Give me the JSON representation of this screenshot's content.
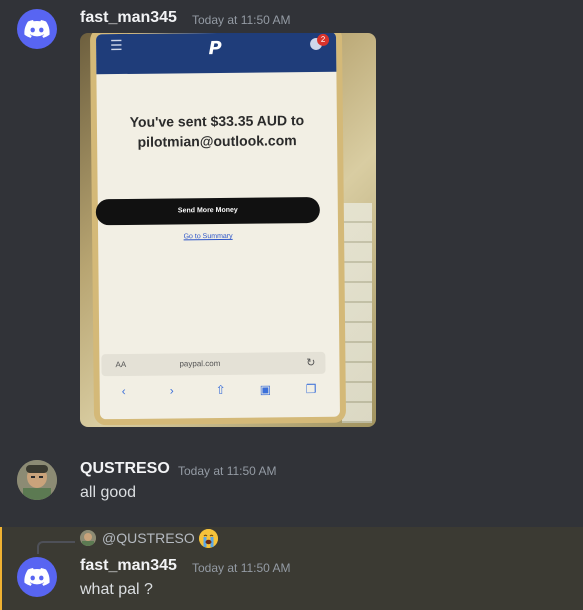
{
  "messages": [
    {
      "username": "fast_man345",
      "timestamp": "Today at 11:50 AM",
      "avatar_icon": "discord-logo-icon",
      "attachment": {
        "sent_text": "You've sent $33.35 AUD to pilotmian@outlook.com",
        "button_label": "Send More Money",
        "link_text": "Go to Summary",
        "url_bar_aa": "AA",
        "url": "paypal.com",
        "badge_count": "2"
      }
    },
    {
      "username": "QUSTRESO",
      "timestamp": "Today at 11:50 AM",
      "content": "all good"
    },
    {
      "reply_mention": "@QUSTRESO",
      "reply_emoji": "loudly-crying-face",
      "username": "fast_man345",
      "timestamp": "Today at 11:50 AM",
      "content": "what pal ?"
    }
  ],
  "colors": {
    "background": "#313338",
    "discord_blurple": "#5865f2",
    "highlight_bg": "#3b3a33",
    "highlight_bar": "#f0b232"
  }
}
